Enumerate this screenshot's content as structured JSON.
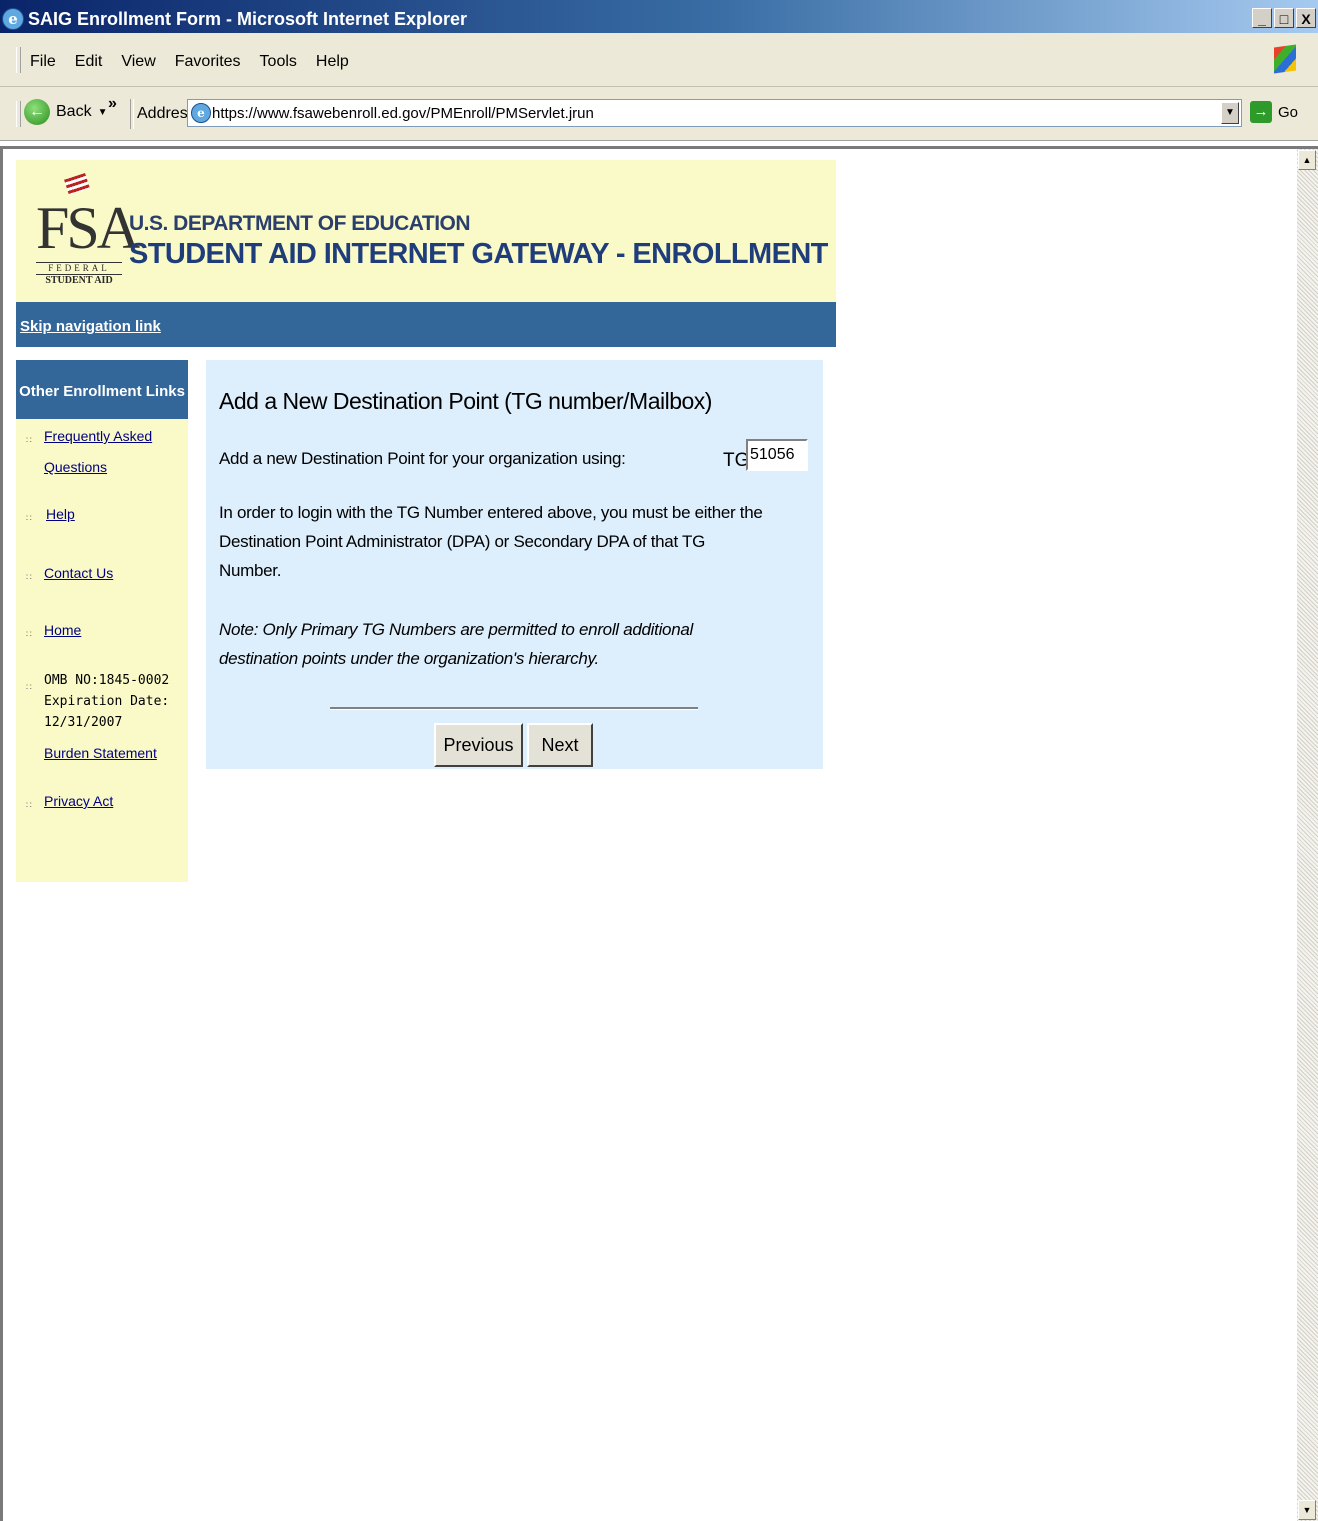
{
  "window": {
    "title": "SAIG Enrollment Form - Microsoft Internet Explorer",
    "controls": [
      "_",
      "□",
      "X"
    ]
  },
  "menu": [
    "File",
    "Edit",
    "View",
    "Favorites",
    "Tools",
    "Help"
  ],
  "toolbar": {
    "back_label": "Back",
    "more": "»",
    "address_label": "Address",
    "url": "https://www.fsawebenroll.ed.gov/PMEnroll/PMServlet.jrun",
    "go_label": "Go"
  },
  "header": {
    "logo_letters": "FSA",
    "logo_federal": "FEDERAL",
    "logo_student_aid": "STUDENT AID",
    "dept": "U.S. DEPARTMENT OF EDUCATION",
    "title": "STUDENT AID INTERNET GATEWAY - ENROLLMENT"
  },
  "nav": {
    "skip_link": "Skip navigation link"
  },
  "sidebar": {
    "heading": "Other Enrollment Links",
    "links": {
      "faq_line1": "Frequently Asked",
      "faq_line2": "Questions",
      "help": "Help",
      "contact": "Contact Us",
      "home": "Home",
      "burden": "Burden Statement",
      "privacy": "Privacy Act"
    },
    "omb": {
      "line1": "OMB NO:1845-0002",
      "line2": "Expiration Date:",
      "line3": "12/31/2007"
    },
    "bullet_glyph": "∷"
  },
  "main": {
    "title": "Add a New Destination Point (TG number/Mailbox)",
    "instruction": "Add a new Destination Point for your organization using:",
    "tg_label": "TG",
    "tg_value": "51056",
    "login_line1": "In order to login with the TG Number entered above, you must be either the",
    "login_line2": "Destination Point Administrator (DPA) or Secondary DPA of that TG",
    "login_line3": "Number.",
    "note_line1": "Note: Only Primary TG Numbers are permitted to enroll additional",
    "note_line2": "destination points under the organization's hierarchy.",
    "previous_label": "Previous",
    "next_label": "Next"
  }
}
